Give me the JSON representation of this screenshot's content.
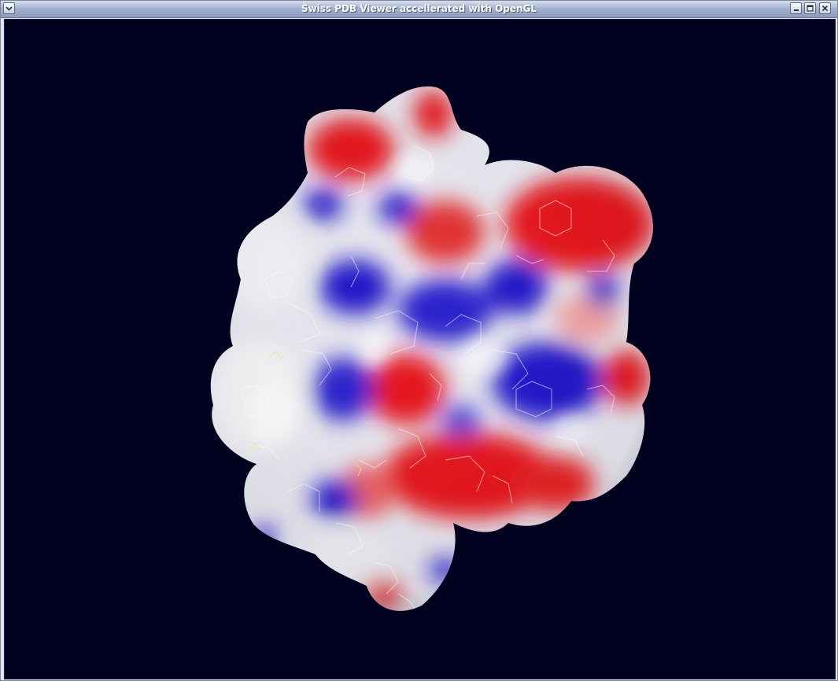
{
  "window": {
    "title": "Swiss PDB Viewer accellerated with OpenGL",
    "controls": {
      "menu_icon": "chevron-down-icon",
      "minimize_icon": "minimize-icon",
      "maximize_icon": "maximize-icon",
      "close_icon": "close-icon"
    }
  },
  "viewport": {
    "background_color": "#02001f",
    "content": "molecular-surface-render",
    "surface_colors": {
      "negative": "#e5141a",
      "neutral": "#e8e8ee",
      "positive": "#2218c8"
    }
  }
}
